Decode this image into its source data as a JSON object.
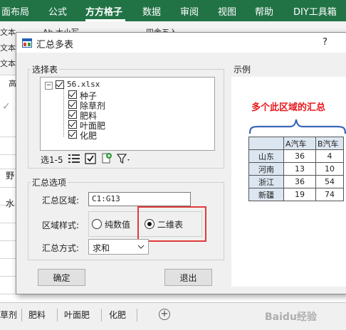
{
  "ribbon": {
    "tabs": [
      "面布局",
      "公式",
      "方方格子",
      "数据",
      "审阅",
      "视图",
      "帮助",
      "DIY工具箱"
    ],
    "fragments": [
      "文本",
      "Ab 大小写",
      "四舍五入",
      "文本",
      "文本",
      "高"
    ]
  },
  "formula": {
    "check": "✓"
  },
  "grid": {
    "left_texts": [
      "野",
      "水"
    ]
  },
  "sheet_tabs": [
    "草剂",
    "肥料",
    "叶面肥",
    "化肥"
  ],
  "sheet_add": "+",
  "watermark": "Baidu经验",
  "dialog": {
    "title": "汇总多表",
    "help": "?",
    "select_group": "选择表",
    "tree": {
      "root": "56.xlsx",
      "collapse": "−",
      "items": [
        "种子",
        "除草剂",
        "肥料",
        "叶面肥",
        "化肥"
      ]
    },
    "select_range": "选1-5",
    "options_group": "汇总选项",
    "region_label": "汇总区域:",
    "region_value": "C1:G13",
    "style_label": "区域样式:",
    "style_options": [
      "纯数值",
      "二维表"
    ],
    "style_selected": 1,
    "method_label": "汇总方式:",
    "method_value": "求和",
    "ok": "确定",
    "exit": "退出",
    "example_group": "示例",
    "example": {
      "title": "多个此区域的汇总",
      "headers": [
        "",
        "A汽车",
        "B汽车"
      ],
      "rows": [
        [
          "山东",
          "36",
          "4"
        ],
        [
          "河南",
          "13",
          "10"
        ],
        [
          "浙江",
          "36",
          "54"
        ],
        [
          "新疆",
          "19",
          "74"
        ]
      ]
    },
    "colors": {
      "highlight": "#e03a3a",
      "example_title": "#e8191e",
      "brace": "#3a67b6",
      "ribbon": "#217346"
    }
  }
}
